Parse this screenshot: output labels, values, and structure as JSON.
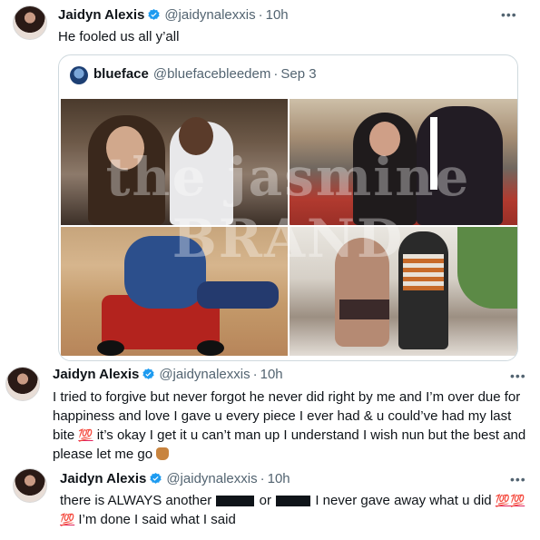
{
  "tweets": [
    {
      "display_name": "Jaidyn Alexis",
      "handle": "@jaidynalexxis",
      "time": "10h",
      "text": "He fooled us all y’all",
      "verified": true
    },
    {
      "display_name": "Jaidyn Alexis",
      "handle": "@jaidynalexxis",
      "time": "10h",
      "text_part1": "I tried to forgive but never forgot he never did right by me and I’m over due for happiness and love I gave u every piece I ever had & u could’ve had my last bite",
      "emoji_100": "💯",
      "text_part2": "it’s okay I get it u can’t man up I understand I wish nun but the best and please let me go",
      "verified": true
    },
    {
      "display_name": "Jaidyn Alexis",
      "handle": "@jaidynalexxis",
      "time": "10h",
      "text_part1": "there is ALWAYS another",
      "text_part2": "or",
      "text_part3": "I never gave away what u did",
      "emoji_100_a": "💯",
      "emoji_100_b": "💯",
      "emoji_100_c": "💯",
      "text_part4": "I’m done I said what I said",
      "verified": true
    }
  ],
  "quoted": {
    "display_name": "blueface",
    "handle": "@bluefacebleedem",
    "time": "Sep 3"
  },
  "watermark": "the jasmine BRAND",
  "more_label": "•••",
  "dot": "·",
  "colors": {
    "verified_blue": "#1d9bf0",
    "secondary_text": "#536471",
    "border": "#cfd9de"
  }
}
